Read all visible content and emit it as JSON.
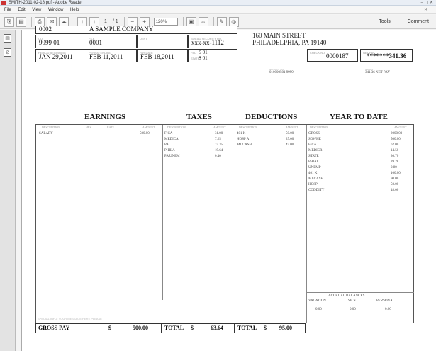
{
  "window": {
    "title": "SMITH-2011-02-18.pdf - Adobe Reader",
    "controls": "–  ▢  ✕"
  },
  "menu": [
    "File",
    "Edit",
    "View",
    "Window",
    "Help"
  ],
  "toolbar": {
    "page_current": "1",
    "page_total": "/ 1",
    "zoom": "120%",
    "tools": "Tools",
    "comment": "Comment"
  },
  "stub": {
    "company": "A SAMPLE COMPANY",
    "company_code": "0002",
    "row1": [
      {
        "label": "CO.",
        "value": "9999    01"
      },
      {
        "label": "FILE",
        "value": "0001"
      },
      {
        "label": "DEPT.",
        "value": ""
      },
      {
        "label": "SOCIAL SECURITY NO.",
        "value": "xxx-xx-1112"
      }
    ],
    "row2": [
      {
        "label": "PERIOD BEGINNING",
        "value": "JAN 29,2011"
      },
      {
        "label": "PERIOD ENDING",
        "value": "FEB 11,2011"
      },
      {
        "label": "PAY DATE",
        "value": "FEB 18,2011"
      },
      {
        "label": "FED",
        "value": "S 01"
      },
      {
        "label": "STATE",
        "value": "S 01"
      }
    ],
    "address_line1": "160 MAIN STREET",
    "address_line2": "PHILADELPHIA, PA 19140",
    "check_no_label": "CHECK NO.",
    "check_no": "0000187",
    "net_pay_label": "NET PAY",
    "net_pay": "*******341.36",
    "deposit_label": "ACCOUNT NO.",
    "deposit_acct": "010000501  9999",
    "deposit_amount_label": "AMOUNT",
    "deposit_amount": "341.36 NET PAY"
  },
  "headings": {
    "earnings": "EARNINGS",
    "taxes": "TAXES",
    "deductions": "DEDUCTIONS",
    "ytd": "YEAR TO DATE"
  },
  "col_labels": {
    "earnings": [
      "DESCRIPTION",
      "HRS",
      "RATE",
      "AMOUNT"
    ],
    "taxes": [
      "DESCRIPTION",
      "AMOUNT"
    ],
    "deductions": [
      "DESCRIPTION",
      "AMOUNT"
    ],
    "ytd": [
      "DESCRIPTION",
      "AMOUNT"
    ]
  },
  "earnings": [
    {
      "desc": "SALARY",
      "amount": "500.00"
    }
  ],
  "taxes": [
    {
      "desc": "FICA",
      "amount": "31.00"
    },
    {
      "desc": "MEDICA",
      "amount": "7.25"
    },
    {
      "desc": "PA",
      "amount": "15.35"
    },
    {
      "desc": "PHILA",
      "amount": "19.64"
    },
    {
      "desc": "PA UNEM",
      "amount": "0.40"
    }
  ],
  "deductions": [
    {
      "desc": "401 K",
      "amount": "50.00"
    },
    {
      "desc": "HOSP A",
      "amount": "25.00"
    },
    {
      "desc": "MJ CASH",
      "amount": "45.00"
    }
  ],
  "ytd": [
    {
      "desc": "GROSS",
      "amount": "2000.00"
    },
    {
      "desc": "SOWHE",
      "amount": "500.00"
    },
    {
      "desc": "FICA",
      "amount": "62.00"
    },
    {
      "desc": "MEDICR",
      "amount": "14.50"
    },
    {
      "desc": "STATE",
      "amount": "30.70"
    },
    {
      "desc": "PHIAL",
      "amount": "39.28"
    },
    {
      "desc": "UNEMP",
      "amount": "0.80"
    },
    {
      "desc": "401 K",
      "amount": "100.00"
    },
    {
      "desc": "MJ CASH",
      "amount": "90.00"
    },
    {
      "desc": "HOSP",
      "amount": "50.00"
    },
    {
      "desc": "CODDITY",
      "amount": "48.00"
    }
  ],
  "accrual": {
    "title": "ACCRUAL BALANCES",
    "headers": [
      "VACATION",
      "SICK",
      "PERSONAL"
    ],
    "values": [
      "0.00",
      "0.00",
      "0.00"
    ]
  },
  "footnote": "SPECIAL INFO: YOUR MESSAGE HERE PLEASE",
  "totals": {
    "gross_label": "GROSS PAY",
    "gross_sign": "$",
    "gross": "500.00",
    "tax_label": "TOTAL",
    "tax_sign": "$",
    "tax": "63.64",
    "ded_label": "TOTAL",
    "ded_sign": "$",
    "ded": "95.00"
  }
}
